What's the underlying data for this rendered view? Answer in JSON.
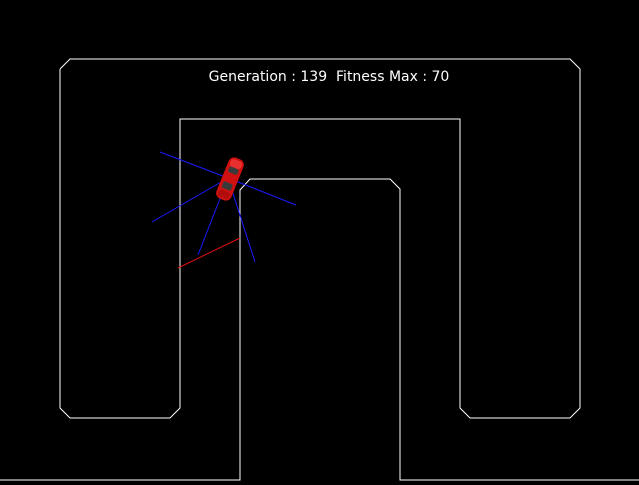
{
  "hud": {
    "generation_label": "Generation : ",
    "generation_value": "139",
    "fitness_label": "Fitness Max : ",
    "fitness_value": "70"
  },
  "colors": {
    "background": "#000000",
    "track_wall": "#ffffff",
    "hud_text": "#ffffff",
    "sensor_ray": "#1a1aff",
    "checkpoint_line": "#e01010",
    "car_body": "#d01010",
    "car_window": "#3a3a3a"
  },
  "icons": {
    "car": "race-car-icon"
  }
}
